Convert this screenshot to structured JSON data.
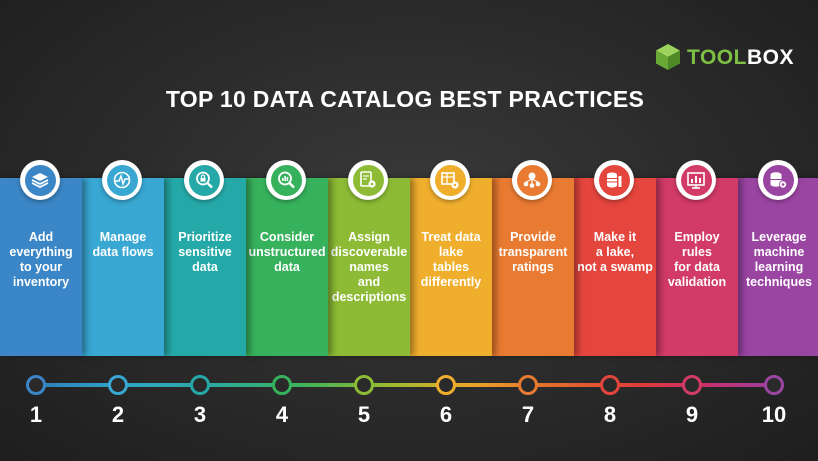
{
  "brand": {
    "tool": "TOOL",
    "box": "BOX",
    "cube_color": "#7dc043"
  },
  "title": "TOP 10 DATA CATALOG BEST PRACTICES",
  "practices": [
    {
      "number": "1",
      "lines": [
        "Add",
        "everything",
        "to your",
        "inventory"
      ],
      "color": "#3b86c6",
      "icon": "layers-icon"
    },
    {
      "number": "2",
      "lines": [
        "Manage",
        "data flows"
      ],
      "color": "#38a7d2",
      "icon": "data-flow-icon"
    },
    {
      "number": "3",
      "lines": [
        "Prioritize",
        "sensitive",
        "data"
      ],
      "color": "#25a9a8",
      "icon": "magnifier-lock-icon"
    },
    {
      "number": "4",
      "lines": [
        "Consider",
        "unstructured",
        "data"
      ],
      "color": "#37b25c",
      "icon": "magnifier-data-icon"
    },
    {
      "number": "5",
      "lines": [
        "Assign",
        "discoverable",
        "names",
        "and",
        "descriptions"
      ],
      "color": "#8dbb35",
      "icon": "document-gear-icon"
    },
    {
      "number": "6",
      "lines": [
        "Treat data",
        "lake",
        "tables",
        "differently"
      ],
      "color": "#f0ae2d",
      "icon": "table-gear-icon"
    },
    {
      "number": "7",
      "lines": [
        "Provide",
        "transparent",
        "ratings"
      ],
      "color": "#e97a31",
      "icon": "rating-network-icon"
    },
    {
      "number": "8",
      "lines": [
        "Make it",
        "a lake,",
        "not a swamp"
      ],
      "color": "#e4453d",
      "icon": "database-shelf-icon"
    },
    {
      "number": "9",
      "lines": [
        "Employ rules",
        "for data",
        "validation"
      ],
      "color": "#d23a67",
      "icon": "validation-board-icon"
    },
    {
      "number": "10",
      "lines": [
        "Leverage",
        "machine",
        "learning",
        "techniques"
      ],
      "color": "#9b45a3",
      "icon": "database-gear-icon"
    }
  ]
}
